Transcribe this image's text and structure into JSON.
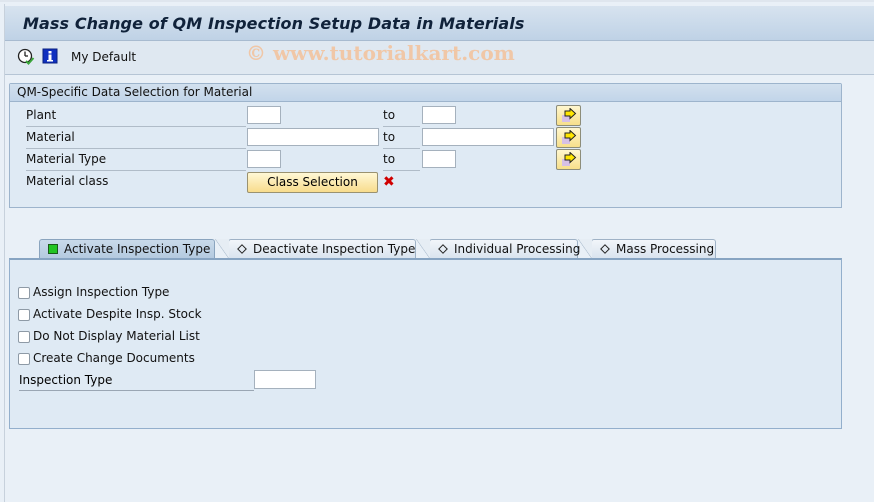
{
  "header": {
    "title": "Mass Change of QM Inspection Setup Data in Materials"
  },
  "toolbar": {
    "execute_icon": "clock-execute-icon",
    "info_icon": "info-icon",
    "variant_label": "My Default",
    "watermark": "© www.tutorialkart.com"
  },
  "selection": {
    "title": "QM-Specific Data Selection for Material",
    "to_label": "to",
    "rows": [
      {
        "label": "Plant",
        "from": "",
        "to": ""
      },
      {
        "label": "Material",
        "from": "",
        "to": ""
      },
      {
        "label": "Material Type",
        "from": "",
        "to": ""
      }
    ],
    "material_class": {
      "label": "Material class",
      "button": "Class Selection",
      "status_icon": "red-x-icon"
    }
  },
  "tabs": [
    {
      "label": "Activate Inspection Type",
      "active": true,
      "marker": "green-square"
    },
    {
      "label": "Deactivate Inspection Type",
      "active": false,
      "marker": "diamond"
    },
    {
      "label": "Individual Processing",
      "active": false,
      "marker": "diamond"
    },
    {
      "label": "Mass Processing",
      "active": false,
      "marker": "diamond"
    }
  ],
  "panel": {
    "checkboxes": [
      {
        "label": "Assign Inspection Type",
        "checked": false
      },
      {
        "label": "Activate Despite Insp. Stock",
        "checked": false
      },
      {
        "label": "Do Not Display Material List",
        "checked": false
      },
      {
        "label": "Create Change Documents",
        "checked": false
      }
    ],
    "inspection_type": {
      "label": "Inspection Type",
      "value": ""
    }
  }
}
